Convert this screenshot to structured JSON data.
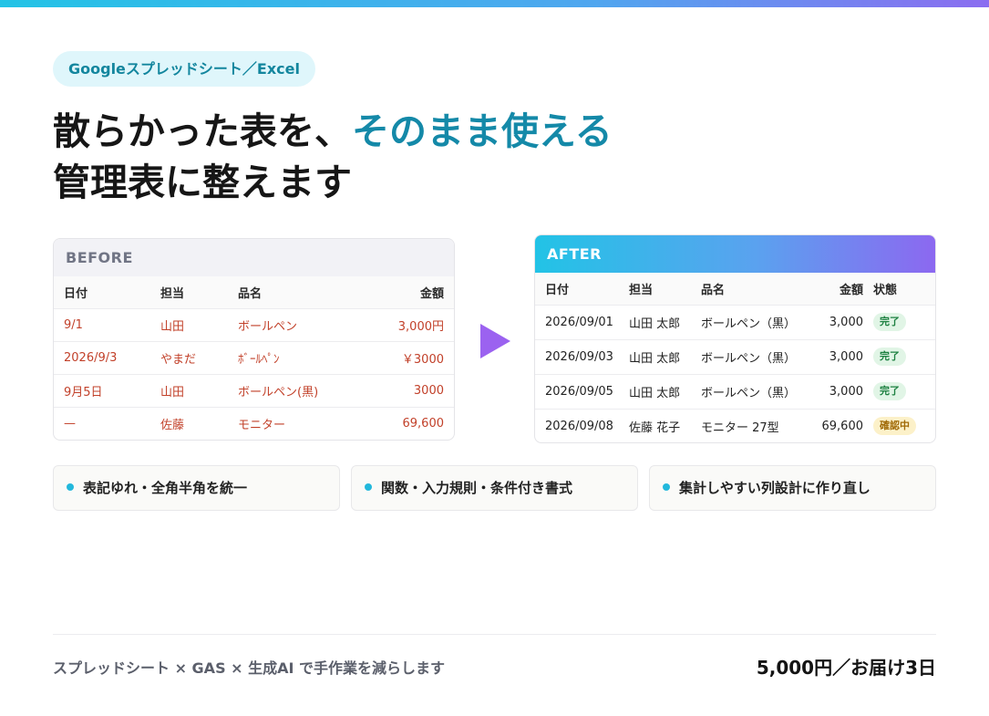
{
  "tag": "Googleスプレッドシート／Excel",
  "headline": {
    "line1_plain": "散らかった表を、",
    "line1_accent": "そのまま使える",
    "line2": "管理表に整えます"
  },
  "before": {
    "title": "BEFORE",
    "columns": [
      "日付",
      "担当",
      "品名",
      "金額"
    ],
    "rows": [
      [
        "9/1",
        "山田",
        "ボールペン",
        "3,000円"
      ],
      [
        "2026/9/3",
        "やまだ",
        "ﾎﾞｰﾙﾍﾟﾝ",
        "￥3000"
      ],
      [
        "9月5日",
        "山田",
        "ボールペン(黒)",
        "3000"
      ],
      [
        "—",
        "佐藤",
        "モニター",
        "69,600"
      ]
    ]
  },
  "after": {
    "title": "AFTER",
    "columns": [
      "日付",
      "担当",
      "品名",
      "金額",
      "状態"
    ],
    "rows": [
      [
        "2026/09/01",
        "山田 太郎",
        "ボールペン（黒）",
        "3,000",
        "完了"
      ],
      [
        "2026/09/03",
        "山田 太郎",
        "ボールペン（黒）",
        "3,000",
        "完了"
      ],
      [
        "2026/09/05",
        "山田 太郎",
        "ボールペン（黒）",
        "3,000",
        "完了"
      ],
      [
        "2026/09/08",
        "佐藤 花子",
        "モニター 27型",
        "69,600",
        "確認中"
      ]
    ]
  },
  "features": [
    "表記ゆれ・全角半角を統一",
    "関数・入力規則・条件付き書式",
    "集計しやすい列設計に作り直し"
  ],
  "footer": {
    "left": "スプレッドシート × GAS × 生成AI で手作業を減らします",
    "right": "5,000円／お届け3日"
  },
  "colors": {
    "accent": "#1489a8",
    "arrow": "#9b62f0",
    "before_text": "#c2412a",
    "done_badge": "#e1f5e6",
    "pending_badge": "#fcf1c9"
  }
}
